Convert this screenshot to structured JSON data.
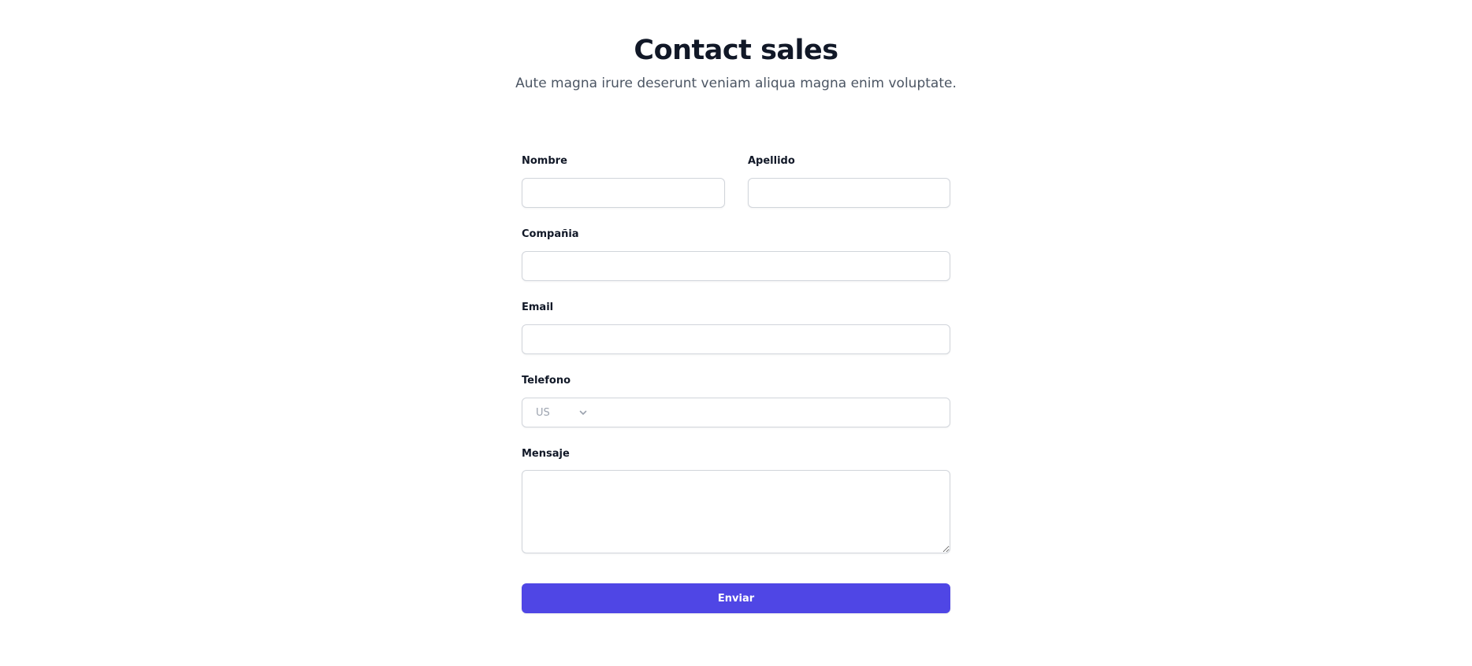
{
  "header": {
    "title": "Contact sales",
    "subtitle": "Aute magna irure deserunt veniam aliqua magna enim voluptate."
  },
  "form": {
    "first_name": {
      "label": "Nombre",
      "value": "",
      "placeholder": ""
    },
    "last_name": {
      "label": "Apellido",
      "value": "",
      "placeholder": ""
    },
    "company": {
      "label": "Compañia",
      "value": "",
      "placeholder": ""
    },
    "email": {
      "label": "Email",
      "value": "",
      "placeholder": ""
    },
    "phone": {
      "label": "Telefono",
      "country": "US",
      "country_icon": "chevron-down-icon",
      "value": "",
      "placeholder": ""
    },
    "message": {
      "label": "Mensaje",
      "value": "",
      "placeholder": ""
    },
    "submit_label": "Enviar"
  },
  "colors": {
    "primary": "#4f46e5",
    "title": "#111827",
    "subtitle": "#4b5563",
    "border": "#d1d5db",
    "muted": "#9ca3af"
  }
}
